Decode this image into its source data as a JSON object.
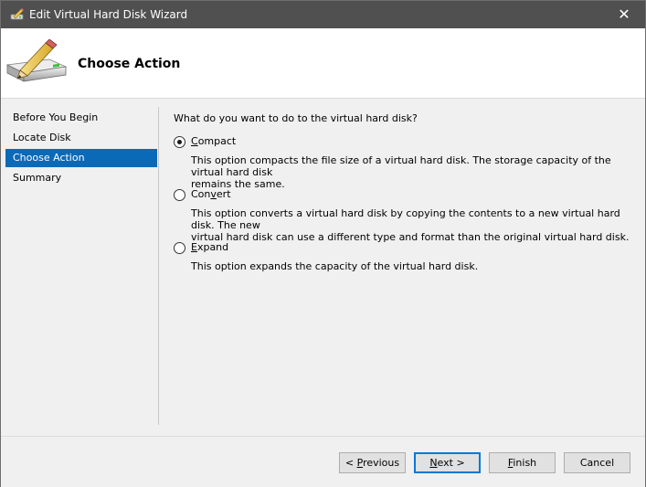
{
  "window": {
    "title": "Edit Virtual Hard Disk Wizard",
    "close_glyph": "✕"
  },
  "header": {
    "title": "Choose Action",
    "icon": "hard-disk-pencil-icon"
  },
  "nav": {
    "items": [
      {
        "label": "Before You Begin",
        "selected": false
      },
      {
        "label": "Locate Disk",
        "selected": false
      },
      {
        "label": "Choose Action",
        "selected": true
      },
      {
        "label": "Summary",
        "selected": false
      }
    ]
  },
  "content": {
    "question": "What do you want to do to the virtual hard disk?",
    "options": [
      {
        "label_pre": "",
        "label_accel": "C",
        "label_post": "ompact",
        "checked": true,
        "desc_line1": "This option compacts the file size of a virtual hard disk. The storage capacity of the virtual hard disk",
        "desc_line2": "remains the same."
      },
      {
        "label_pre": "Con",
        "label_accel": "v",
        "label_post": "ert",
        "checked": false,
        "desc_line1": "This option converts a virtual hard disk by copying the contents to a new virtual hard disk. The new",
        "desc_line2": "virtual hard disk can use a different type and format than the original virtual hard disk."
      },
      {
        "label_pre": "",
        "label_accel": "E",
        "label_post": "xpand",
        "checked": false,
        "desc_line1": "This option expands the capacity of the virtual hard disk.",
        "desc_line2": ""
      }
    ]
  },
  "footer": {
    "previous": {
      "pre": "< ",
      "accel": "P",
      "post": "revious"
    },
    "next": {
      "pre": "",
      "accel": "N",
      "post": "ext >"
    },
    "finish": {
      "pre": "",
      "accel": "F",
      "post": "inish"
    },
    "cancel": "Cancel"
  },
  "colors": {
    "titlebar": "#505050",
    "selection": "#0b6ab8",
    "default_button_border": "#0078d7"
  }
}
